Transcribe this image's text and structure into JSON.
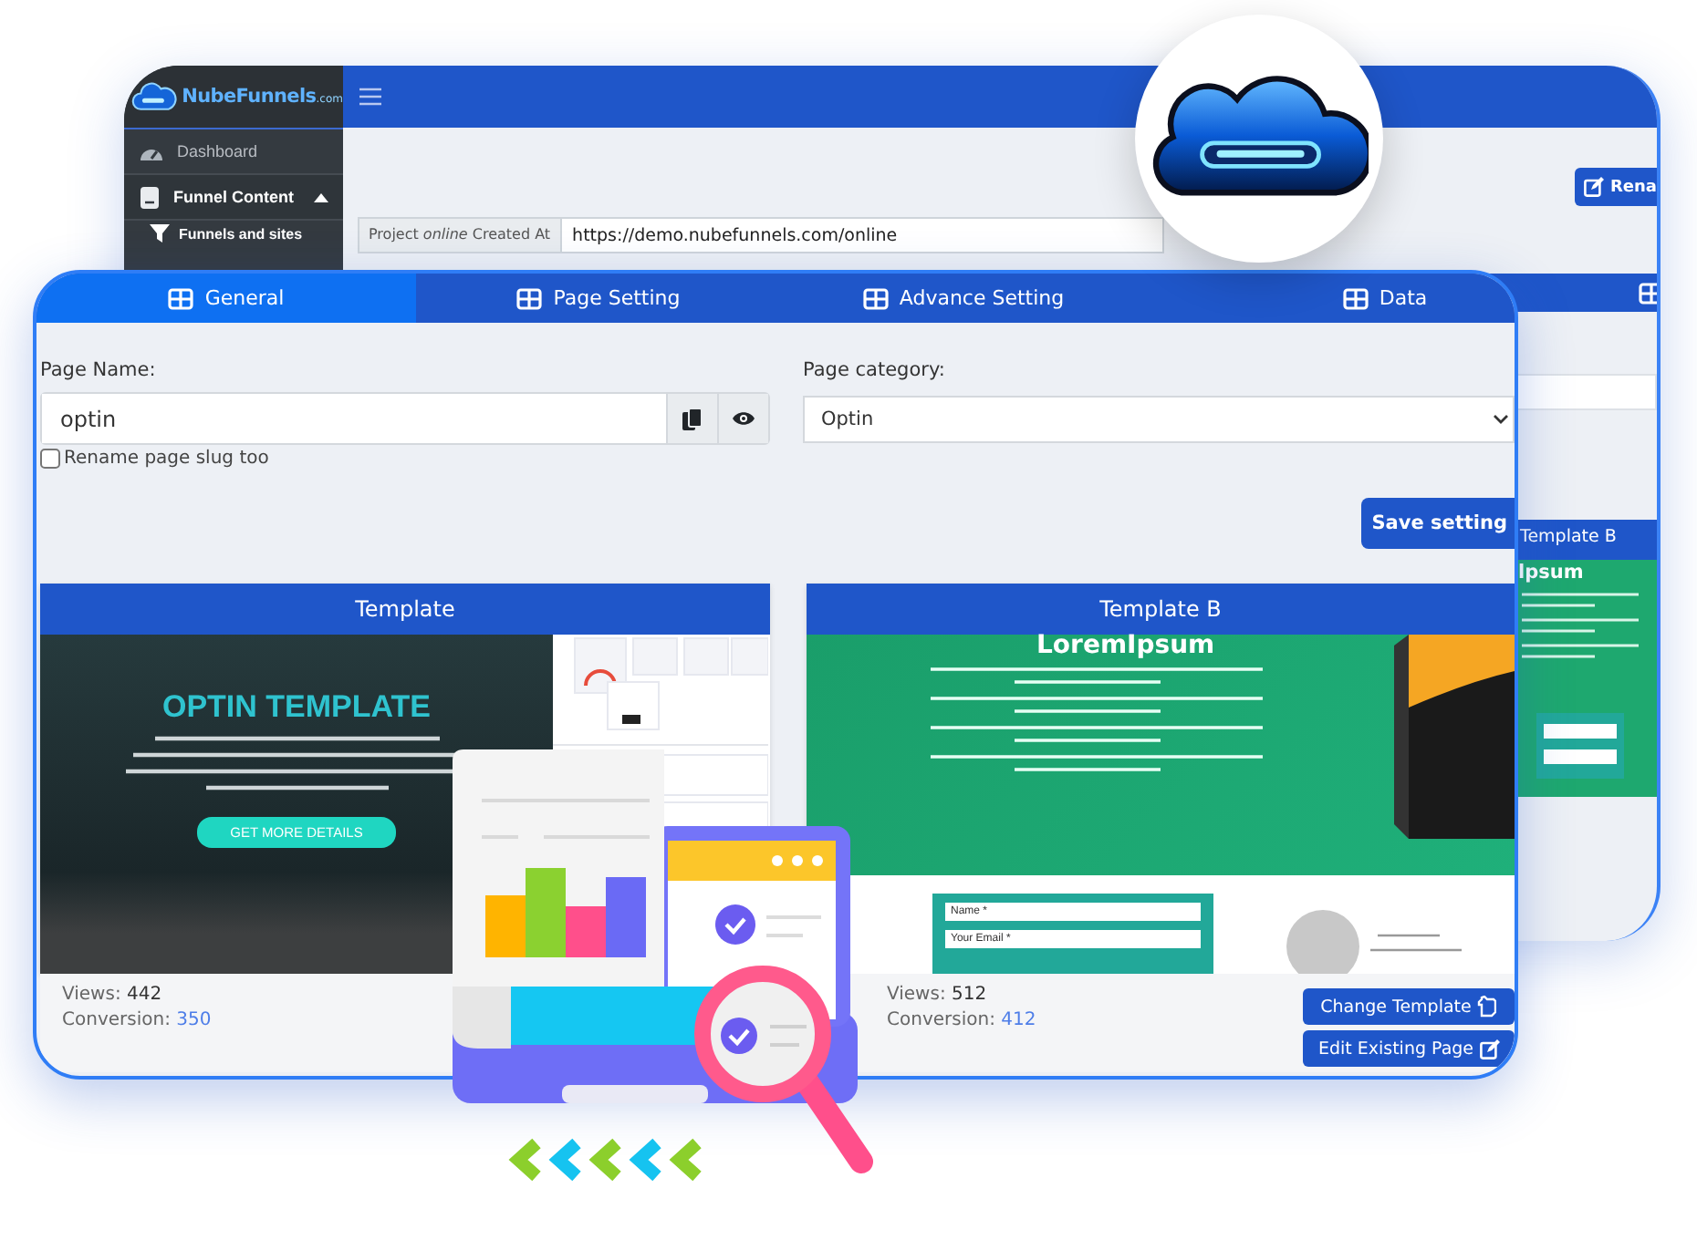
{
  "back_window": {
    "logo": {
      "name": "NubeFunnels",
      "suffix": ".com"
    },
    "sidebar": {
      "items": [
        {
          "label": "Dashboard",
          "selected": false
        },
        {
          "label": "Funnel Content",
          "selected": true,
          "expanded": true,
          "children": [
            {
              "label": "Funnels and sites"
            }
          ]
        }
      ]
    },
    "rename_button": "Rena",
    "project": {
      "label": "Project *online* Created At",
      "value": "https://demo.nubefunnels.com/online"
    },
    "preview_card": {
      "title": "Template B",
      "heading": "lpsum"
    }
  },
  "front_window": {
    "tabs": [
      {
        "label": "General",
        "selected": true
      },
      {
        "label": "Page Setting",
        "selected": false
      },
      {
        "label": "Advance Setting",
        "selected": false
      },
      {
        "label": "Data",
        "selected": false
      }
    ],
    "page_name": {
      "label": "Page Name:",
      "value": "optin"
    },
    "rename_slug": {
      "label": "Rename page slug too",
      "checked": false
    },
    "page_category": {
      "label": "Page category:",
      "value": "Optin"
    },
    "save_button": "Save setting",
    "templates": [
      {
        "kind": "optin",
        "title": "Template",
        "hero_title": "OPTIN TEMPLATE",
        "cta": "GET MORE DETAILS",
        "views_label": "Views:",
        "views": "442",
        "conversion_label": "Conversion:",
        "conversion": "350"
      },
      {
        "kind": "lead",
        "title": "Template B",
        "hero_title": "LoremIpsum",
        "form_fields": [
          "Name *",
          "Your Email *"
        ],
        "views_label": "Views:",
        "views": "512",
        "conversion_label": "Conversion:",
        "conversion": "412"
      }
    ],
    "buttons": [
      {
        "label": "Change Template",
        "kind": "change"
      },
      {
        "label": "Edit Existing Page",
        "kind": "edit"
      }
    ]
  }
}
